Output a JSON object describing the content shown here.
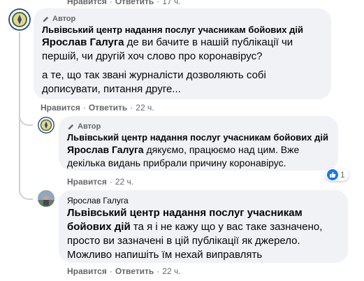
{
  "top_partial": {
    "like": "Нравится",
    "reply": "Ответить",
    "time": "17 ч."
  },
  "comments": [
    {
      "badge": "Автор",
      "author": "Львівський центр надання послуг учасникам бойових дій",
      "mention": "Ярослав Галуга",
      "para1": " де ви бачите в нашій публікації чи першій, чи другій хоч слово про коронавірус?",
      "para2": "а те, що так звані журналісти дозволяють собі дописувати, питання друге...",
      "like": "Нравится",
      "reply": "Ответить",
      "time": "22 ч."
    },
    {
      "badge": "Автор",
      "author": "Львівський центр надання послуг учасникам бойових дій",
      "mention": "Ярослав Галуга",
      "para1": " дякуємо, працюємо над цим. Вже декілька видань прибрали причину коронавірус.",
      "reaction_count": "1",
      "like": "Нравится",
      "reply": "",
      "time": "22 ч."
    },
    {
      "author": "Ярослав Галуга",
      "mention": "Львівський центр надання послуг учасникам бойових дій",
      "para1": " та я і не кажу що у вас таке зазначено, просто ви зазначені в цій публікації як джерело. Можливо напишіть їм нехай виправлять",
      "like": "Нравится",
      "reply": "Ответить",
      "time": "22 ч."
    }
  ],
  "separator": "·",
  "colors": {
    "bubble": "#f0f2f5",
    "secondary_text": "#65676b",
    "like_blue": "#1877f2"
  }
}
